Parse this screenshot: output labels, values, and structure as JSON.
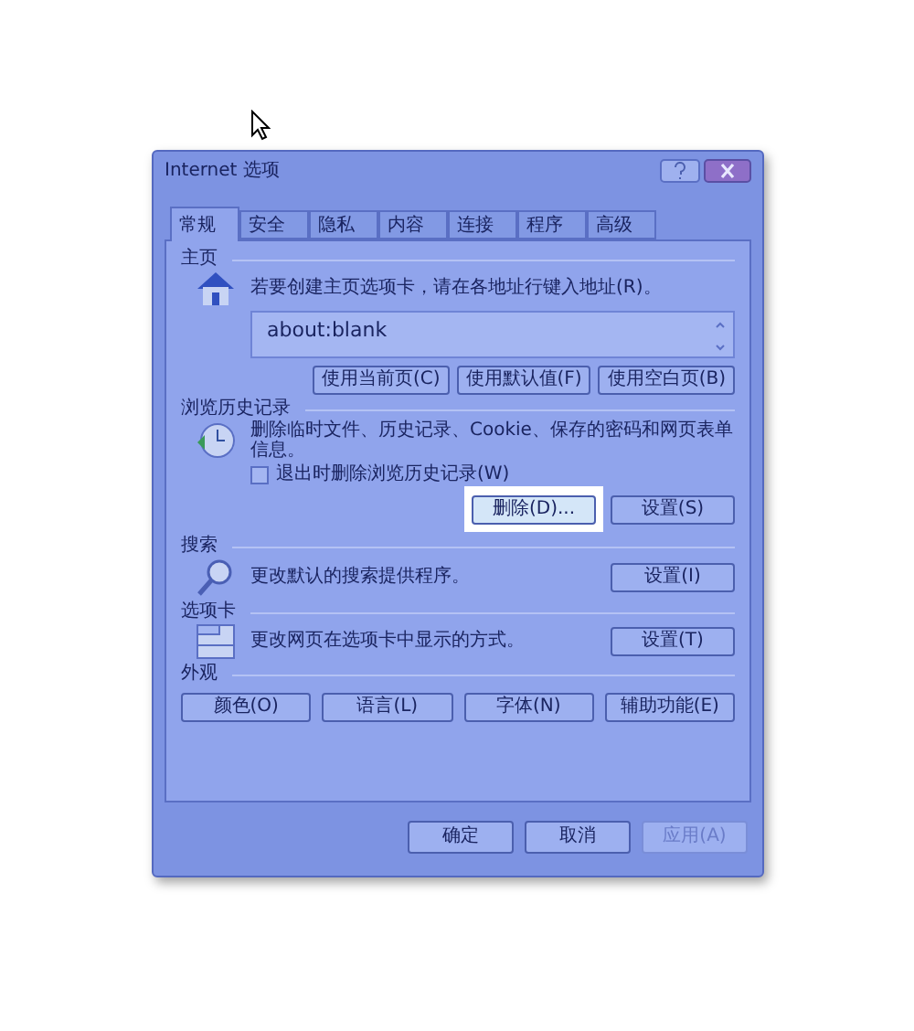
{
  "window": {
    "title": "Internet 选项"
  },
  "tabs": [
    {
      "label": "常规",
      "selected": true
    },
    {
      "label": "安全",
      "selected": false
    },
    {
      "label": "隐私",
      "selected": false
    },
    {
      "label": "内容",
      "selected": false
    },
    {
      "label": "连接",
      "selected": false
    },
    {
      "label": "程序",
      "selected": false
    },
    {
      "label": "高级",
      "selected": false
    }
  ],
  "homepage": {
    "heading": "主页",
    "description": "若要创建主页选项卡，请在各地址行键入地址(R)。",
    "url": "about:blank",
    "buttons": [
      "使用当前页(C)",
      "使用默认值(F)",
      "使用空白页(B)"
    ]
  },
  "history": {
    "heading": "浏览历史记录",
    "description": "删除临时文件、历史记录、Cookie、保存的密码和网页表单信息。",
    "checkbox": {
      "label": "退出时删除浏览历史记录(W)",
      "checked": false
    },
    "buttons": [
      {
        "label": "删除(D)...",
        "highlighted": true
      },
      {
        "label": "设置(S)",
        "highlighted": false
      }
    ]
  },
  "search": {
    "heading": "搜索",
    "description": "更改默认的搜索提供程序。",
    "button": "设置(I)"
  },
  "tabs_section": {
    "heading": "选项卡",
    "description": "更改网页在选项卡中显示的方式。",
    "button": "设置(T)"
  },
  "appearance": {
    "heading": "外观",
    "buttons": [
      "颜色(O)",
      "语言(L)",
      "字体(N)",
      "辅助功能(E)"
    ]
  },
  "footer": [
    {
      "label": "确定",
      "disabled": false
    },
    {
      "label": "取消",
      "disabled": false
    },
    {
      "label": "应用(A)",
      "disabled": true
    }
  ]
}
